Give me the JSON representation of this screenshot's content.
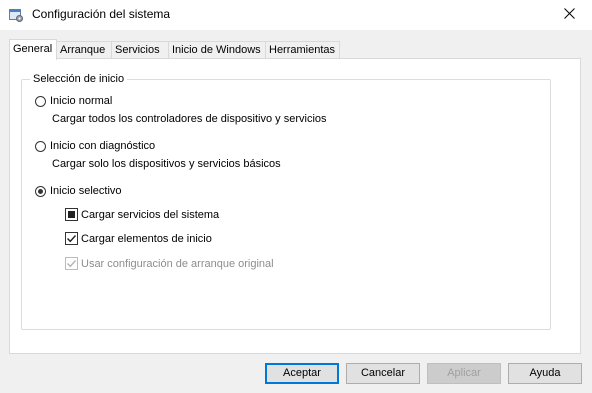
{
  "window": {
    "title": "Configuración del sistema"
  },
  "tabs": [
    {
      "label": "General",
      "active": true
    },
    {
      "label": "Arranque"
    },
    {
      "label": "Servicios"
    },
    {
      "label": "Inicio de Windows"
    },
    {
      "label": "Herramientas"
    }
  ],
  "startup_group": {
    "title": "Selección de inicio",
    "normal": {
      "label": "Inicio normal",
      "description": "Cargar todos los controladores de dispositivo y servicios",
      "selected": false
    },
    "diagnostic": {
      "label": "Inicio con diagnóstico",
      "description": "Cargar solo los dispositivos y servicios básicos",
      "selected": false
    },
    "selective": {
      "label": "Inicio selectivo",
      "selected": true,
      "load_services": {
        "label": "Cargar servicios del sistema",
        "state": "indeterminate"
      },
      "load_startup": {
        "label": "Cargar elementos de inicio",
        "state": "checked"
      },
      "use_original": {
        "label": "Usar configuración de arranque original",
        "state": "checked",
        "enabled": false
      }
    }
  },
  "buttons": {
    "ok": "Aceptar",
    "cancel": "Cancelar",
    "apply": "Aplicar",
    "help": "Ayuda"
  },
  "colors": {
    "accent": "#0078d7",
    "window_bg": "#f0f0f0"
  }
}
